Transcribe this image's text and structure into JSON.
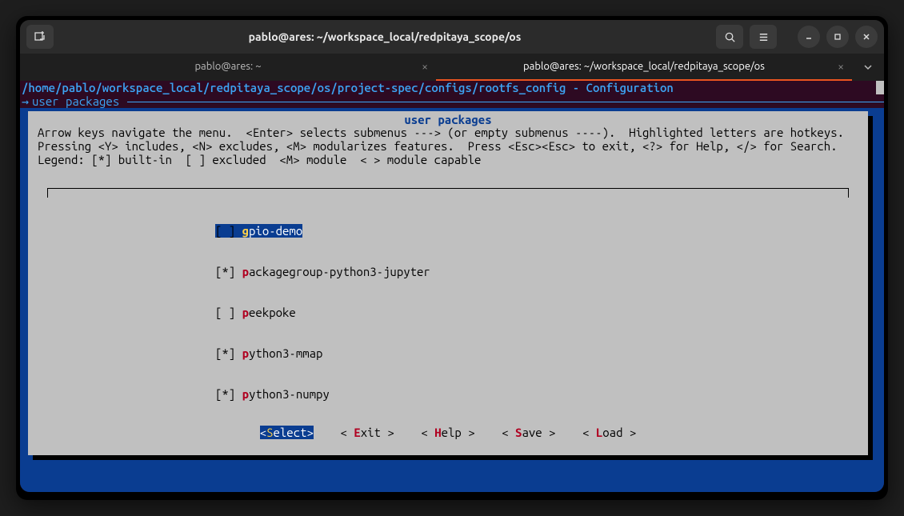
{
  "window": {
    "title": "pablo@ares: ~/workspace_local/redpitaya_scope/os"
  },
  "tabs": [
    {
      "label": "pablo@ares: ~",
      "active": false
    },
    {
      "label": "pablo@ares: ~/workspace_local/redpitaya_scope/os",
      "active": true
    }
  ],
  "terminal": {
    "path_line": "/home/pablo/workspace_local/redpitaya_scope/os/project-spec/configs/rootfs_config - Configuration",
    "sub_heading": "user packages"
  },
  "dialog": {
    "title": "user packages",
    "help_line1": "Arrow keys navigate the menu.  <Enter> selects submenus ---> (or empty submenus ----).  Highlighted letters are hotkeys.",
    "help_line2": "Pressing <Y> includes, <N> excludes, <M> modularizes features.  Press <Esc><Esc> to exit, <?> for Help, </> for Search.",
    "help_line3": "Legend: [*] built-in  [ ] excluded  <M> module  < > module capable",
    "items": [
      {
        "state": "[ ]",
        "hot": "g",
        "rest": "pio-demo",
        "selected": true
      },
      {
        "state": "[*]",
        "hot": "p",
        "rest": "ackagegroup-python3-jupyter",
        "selected": false
      },
      {
        "state": "[ ]",
        "hot": "p",
        "rest": "eekpoke",
        "selected": false
      },
      {
        "state": "[*]",
        "hot": "p",
        "rest": "ython3-mmap",
        "selected": false
      },
      {
        "state": "[*]",
        "hot": "p",
        "rest": "ython3-numpy",
        "selected": false
      }
    ],
    "buttons": {
      "select": {
        "open": "<",
        "hot": "S",
        "rest": "elect",
        "close": ">"
      },
      "exit": {
        "open": "< ",
        "hot": "E",
        "rest": "xit ",
        "close": ">"
      },
      "help": {
        "open": "< ",
        "hot": "H",
        "rest": "elp ",
        "close": ">"
      },
      "save": {
        "open": "< ",
        "hot": "S",
        "rest": "ave ",
        "close": ">"
      },
      "load": {
        "open": "< ",
        "hot": "L",
        "rest": "oad ",
        "close": ">"
      }
    }
  }
}
